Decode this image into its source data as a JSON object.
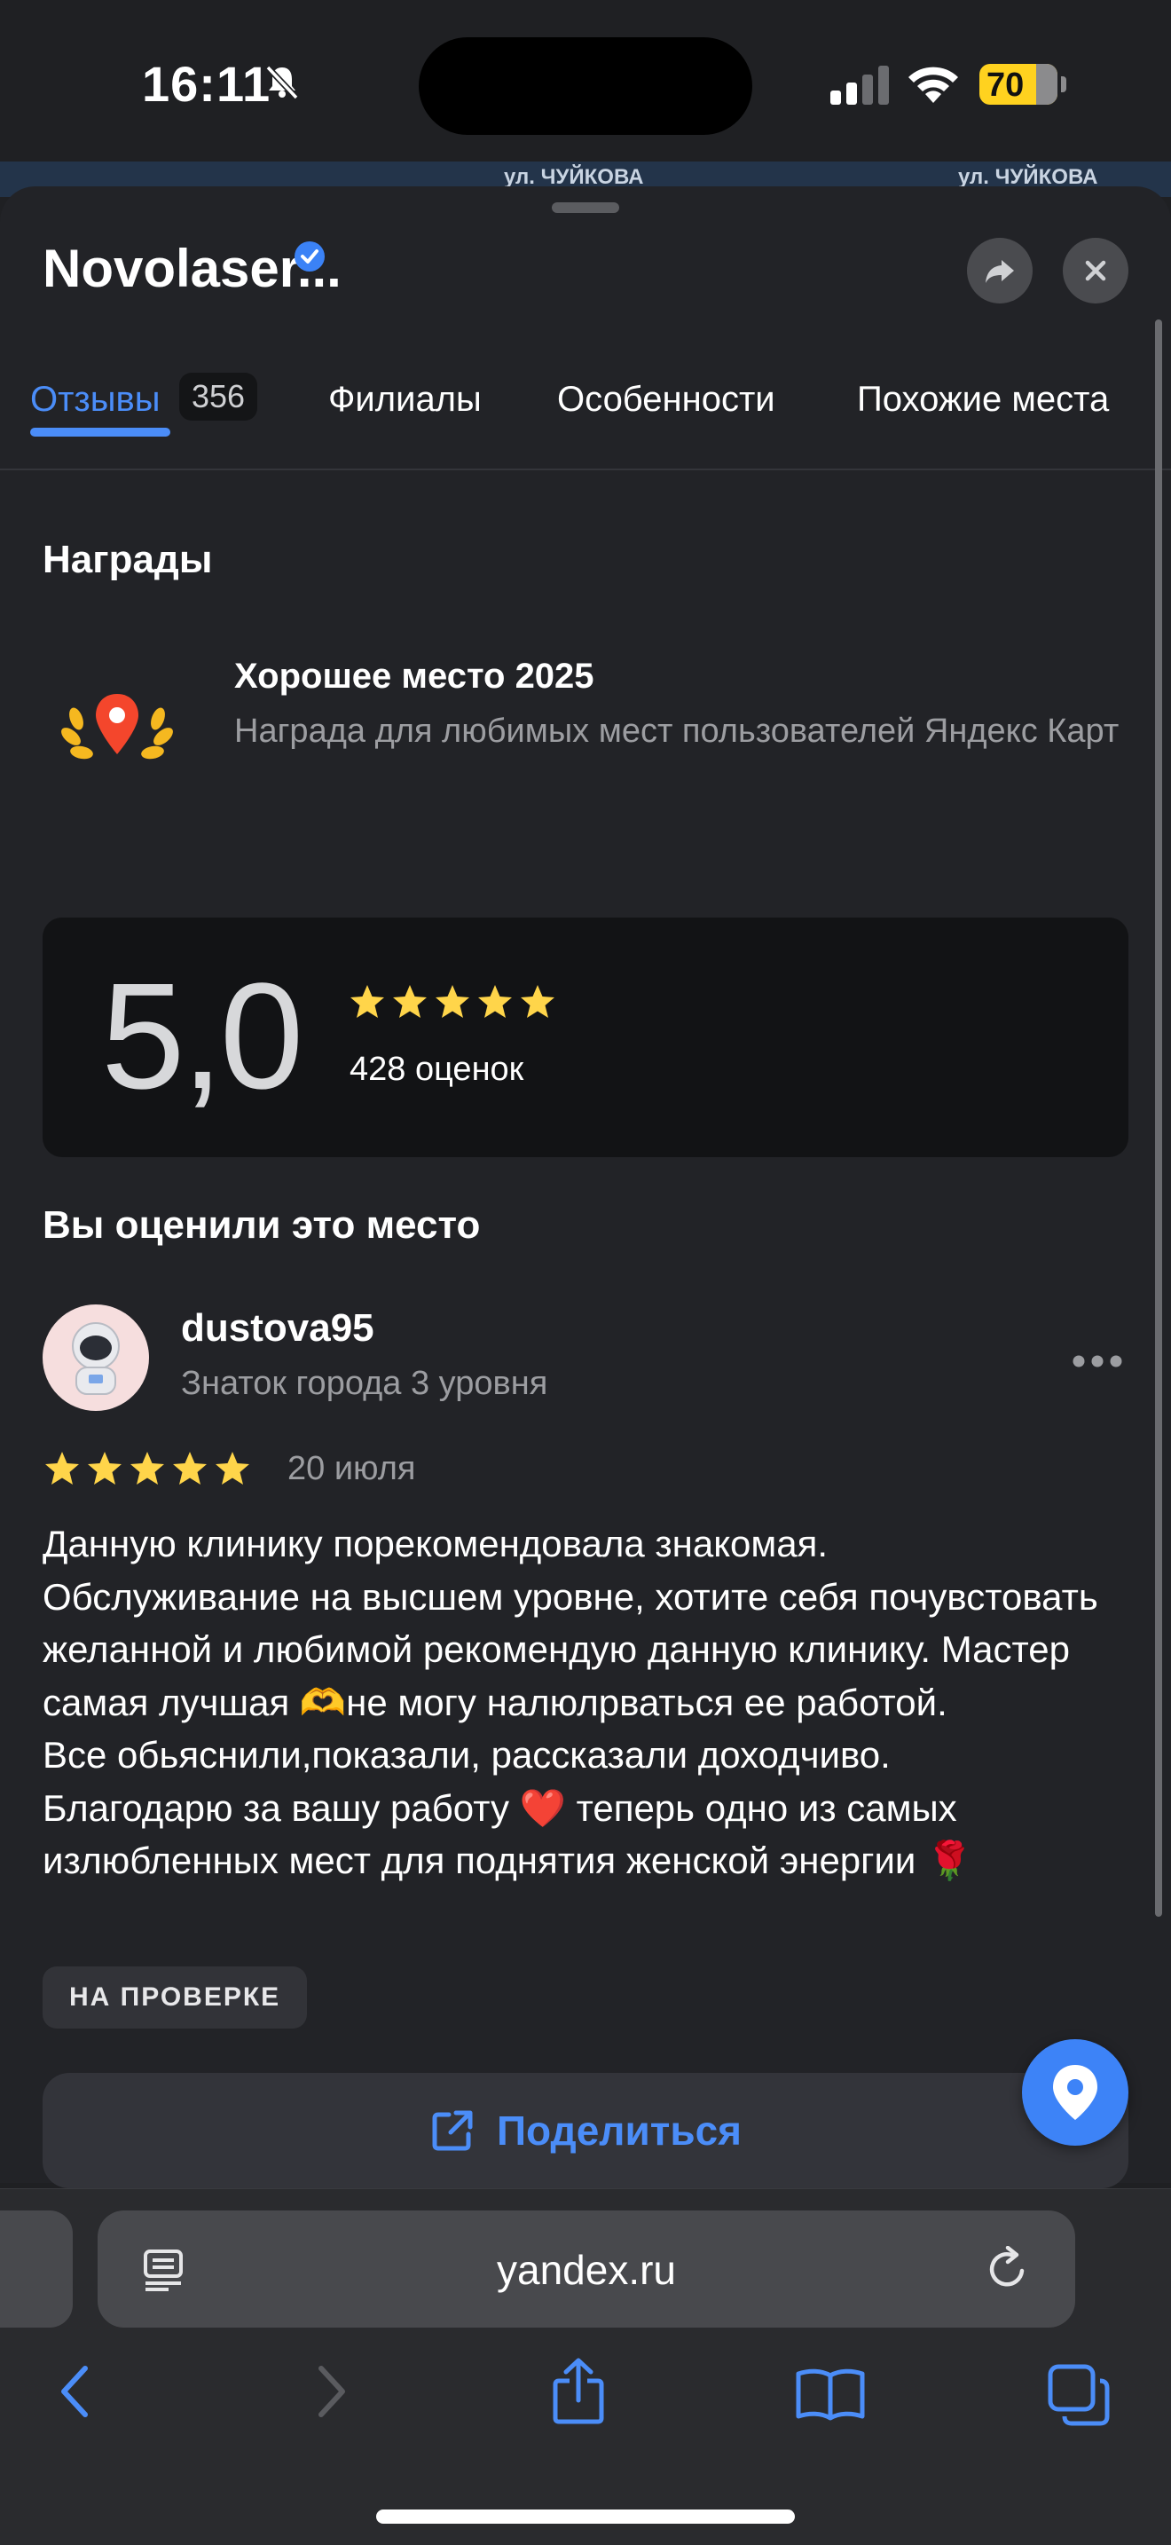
{
  "status_bar": {
    "time": "16:11",
    "battery": "70"
  },
  "map": {
    "street_left": "ул. ЧУЙКОВА",
    "street_right": "ул. ЧУЙКОВА"
  },
  "place": {
    "title": "Novolaser..."
  },
  "tabs": [
    {
      "label": "Отзывы",
      "badge": "356",
      "active": true
    },
    {
      "label": "Филиалы"
    },
    {
      "label": "Особенности"
    },
    {
      "label": "Похожие места"
    }
  ],
  "awards": {
    "heading": "Награды",
    "title": "Хорошее место 2025",
    "description": "Награда для любимых мест пользователей Яндекс Карт"
  },
  "rating": {
    "value": "5,0",
    "stars": 5,
    "count_label": "428 оценок"
  },
  "your_review": {
    "heading": "Вы оценили это место",
    "username": "dustova95",
    "level": "Знаток города 3 уровня",
    "stars": 5,
    "date": "20 июля",
    "text": "Данную клинику порекомендовала знакомая.\nОбслуживание на высшем уровне, хотите себя почувстовать желанной и любимой рекомендую данную клинику. Мастер самая лучшая 🫶не могу налюлрваться ее работой.\nВсе обьяснили,показали, рассказали доходчиво.\nБлагодарю за вашу работу ❤️ теперь одно из самых излюбленных мест для поднятия женской энергии 🌹",
    "status": "НА ПРОВЕРКЕ"
  },
  "share": {
    "label": "Поделиться"
  },
  "browser": {
    "url": "yandex.ru"
  },
  "colors": {
    "accent": "#4b8df8",
    "star": "#ffd54a",
    "background": "#222327"
  },
  "icons": [
    "bell-slash-icon",
    "signal-icon",
    "wifi-icon",
    "verified-icon",
    "share-icon",
    "close-icon",
    "award-pin-icon",
    "star-icon",
    "more-icon",
    "external-share-icon",
    "location-pin-icon",
    "reader-icon",
    "reload-icon",
    "back-icon",
    "forward-icon",
    "share-sheet-icon",
    "bookmarks-icon",
    "tabs-icon"
  ]
}
